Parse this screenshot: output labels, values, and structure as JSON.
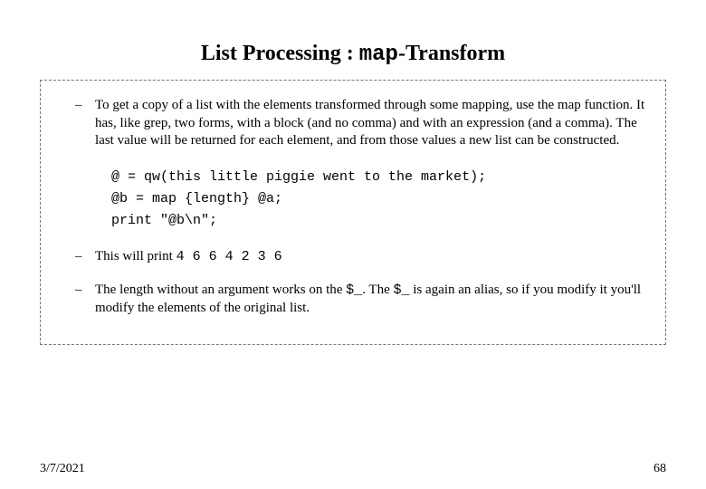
{
  "title": {
    "prefix": "List Processing : ",
    "mono": "map",
    "suffix": "-Transform"
  },
  "bullets": {
    "b1": "To get a copy of a list with the elements transformed through some mapping, use the map function. It has, like grep, two forms, with a block (and no comma) and with an expression (and a comma). The last value will be returned for each element, and from those values a new list can be constructed.",
    "code": "@ = qw(this little piggie went to the market);\n@b = map {length} @a;\nprint \"@b\\n\";",
    "b2_prefix": "This will print ",
    "b2_mono": "4 6 6 4 2 3 6",
    "b3_p1": "The length without an argument works on the ",
    "b3_m1": "$_",
    "b3_p2": ". The ",
    "b3_m2": "$_",
    "b3_p3": " is again an alias, so if you modify it you'll modify the elements of the original list."
  },
  "footer": {
    "date": "3/7/2021",
    "page": "68"
  }
}
